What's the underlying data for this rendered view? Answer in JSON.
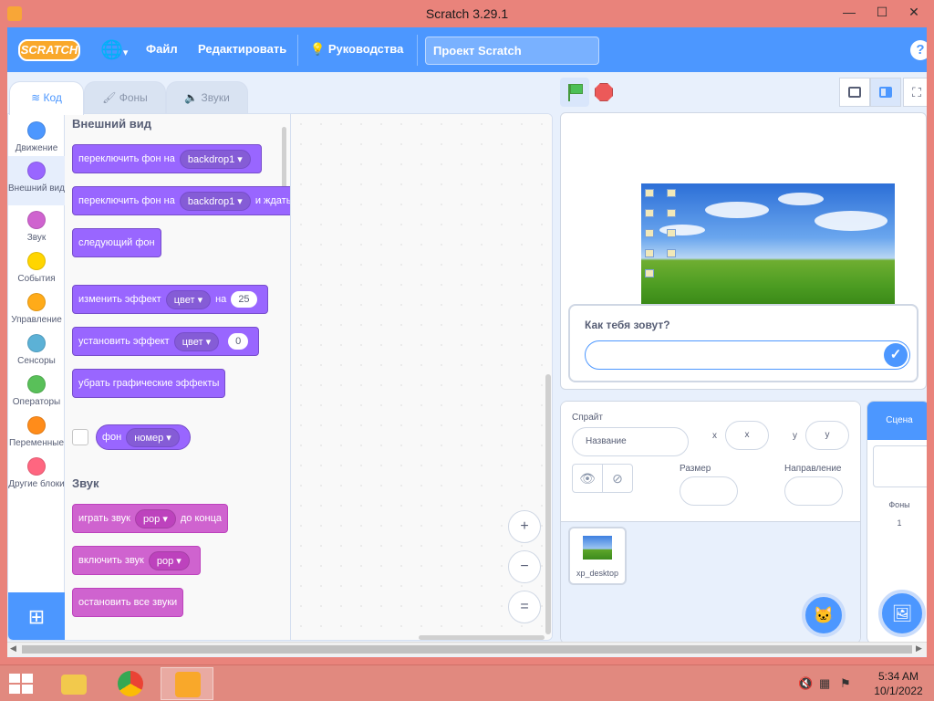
{
  "window": {
    "title": "Scratch 3.29.1",
    "minimize": "—",
    "maximize": "☐",
    "close": "✕"
  },
  "menubar": {
    "logo": "SCRATCH",
    "file": "Файл",
    "edit": "Редактировать",
    "tutorials": "Руководства",
    "project_title": "Проект Scratch",
    "help": "?"
  },
  "tabs": {
    "code": "Код",
    "costumes": "Фоны",
    "sounds": "Звуки"
  },
  "categories": [
    {
      "label": "Движение",
      "color": "#4c97ff"
    },
    {
      "label": "Внешний вид",
      "color": "#9966ff"
    },
    {
      "label": "Звук",
      "color": "#cf63cf"
    },
    {
      "label": "События",
      "color": "#ffd500"
    },
    {
      "label": "Управление",
      "color": "#ffab19"
    },
    {
      "label": "Сенсоры",
      "color": "#5cb1d6"
    },
    {
      "label": "Операторы",
      "color": "#59c059"
    },
    {
      "label": "Переменные",
      "color": "#ff8c1a"
    },
    {
      "label": "Другие блоки",
      "color": "#ff6680"
    }
  ],
  "palette": {
    "looks_title": "Внешний вид",
    "switch_backdrop": {
      "text": "переключить фон на",
      "arg": "backdrop1"
    },
    "switch_backdrop_wait": {
      "text": "переключить фон на",
      "arg": "backdrop1",
      "suffix": "и ждать"
    },
    "next_backdrop": "следующий фон",
    "change_effect": {
      "text": "изменить эффект",
      "arg": "цвет",
      "mid": "на",
      "value": "25"
    },
    "set_effect": {
      "text": "установить эффект",
      "arg": "цвет",
      "value": "0"
    },
    "clear_effects": "убрать графические эффекты",
    "backdrop_reporter": {
      "text": "фон",
      "arg": "номер"
    },
    "sound_title": "Звук",
    "play_sound": {
      "text": "играть звук",
      "arg": "pop",
      "suffix": "до конца"
    },
    "start_sound": {
      "text": "включить звук",
      "arg": "pop"
    },
    "stop_sounds": "остановить все звуки"
  },
  "zoom": {
    "in": "+",
    "out": "−",
    "reset": "="
  },
  "stage": {
    "ask_question": "Как тебя зовут?",
    "ask_answer": "",
    "ask_ok": "✓"
  },
  "sprite_info": {
    "sprite_label": "Спрайт",
    "name_placeholder": "Название",
    "x_label": "x",
    "x_placeholder": "x",
    "y_label": "y",
    "y_placeholder": "y",
    "size_label": "Размер",
    "direction_label": "Направление",
    "show_icon": "👁",
    "hide_icon": "⊘"
  },
  "sprites": [
    {
      "name": "xp_desktop"
    }
  ],
  "stage_pane": {
    "header": "Сцена",
    "backdrops_label": "Фоны",
    "backdrops_count": "1"
  },
  "taskbar": {
    "time": "5:34 AM",
    "date": "10/1/2022"
  }
}
